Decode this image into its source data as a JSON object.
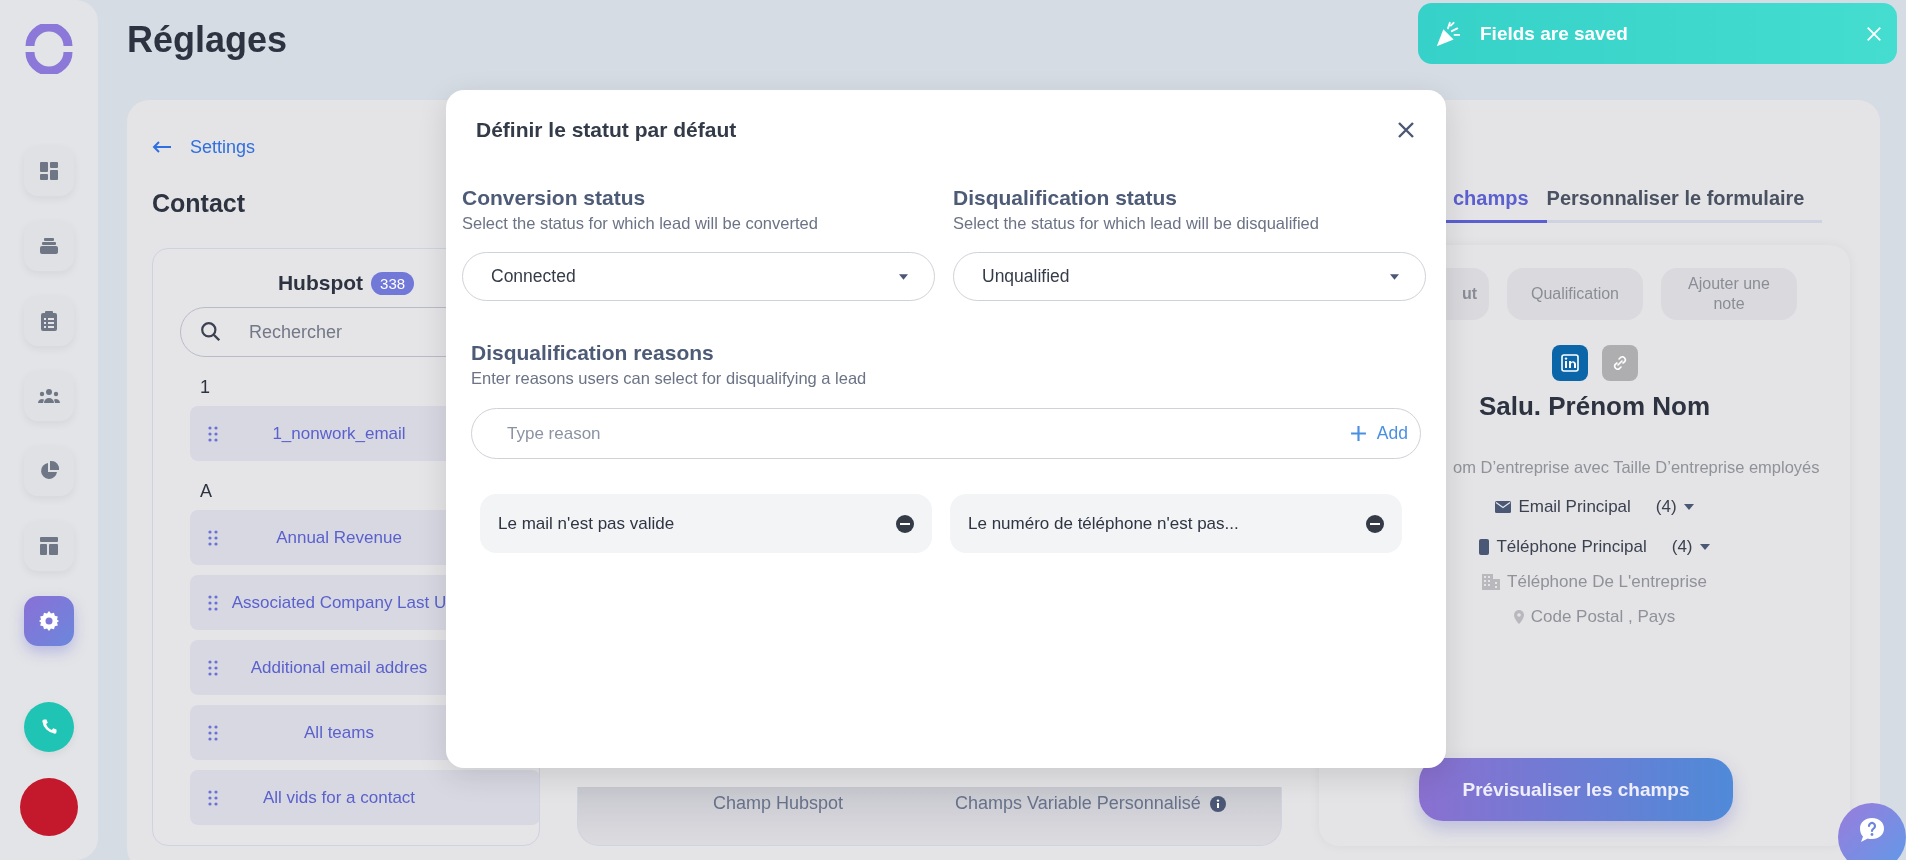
{
  "sidebar": {
    "items": [
      {
        "kind": "dashboard",
        "selected": false
      },
      {
        "kind": "stack",
        "selected": false
      },
      {
        "kind": "clipboard",
        "selected": false
      },
      {
        "kind": "team",
        "selected": false
      },
      {
        "kind": "pie",
        "selected": false
      },
      {
        "kind": "layout",
        "selected": false
      },
      {
        "kind": "settings",
        "selected": true
      },
      {
        "kind": "phone",
        "selected": false
      }
    ]
  },
  "page_title": "Réglages",
  "back_link": "Settings",
  "section_title": "Contact",
  "source_panel": {
    "title": "Hubspot",
    "count": "338",
    "search": {
      "placeholder": "Rechercher"
    },
    "groups": [
      {
        "letter": "1",
        "fields": [
          "1_nonwork_email"
        ]
      },
      {
        "letter": "A",
        "fields": [
          "Annual Revenue",
          "Associated Company Last U",
          "Additional email addres",
          "All teams",
          "All vids for a contact"
        ]
      }
    ]
  },
  "mapping_table": {
    "columns": [
      "Champ Hubspot",
      "Champs Variable Personnalisé"
    ]
  },
  "form_tabs": [
    {
      "label": "champs",
      "selected": true
    },
    {
      "label": "Personnaliser le formulaire",
      "selected": false
    }
  ],
  "preview": {
    "chips": [
      "ut",
      "Qualification",
      "Ajouter une note"
    ],
    "name": "Salu. Prénom Nom",
    "company_line": "om D’entreprise avec Taille D’entreprise employés",
    "contacts": [
      {
        "kind": "email",
        "label": "Email Principal",
        "count": "(4)"
      },
      {
        "kind": "phone",
        "label": "Téléphone Principal",
        "count": "(4)"
      },
      {
        "kind": "company_phone",
        "label": "Téléphone De L'entreprise"
      },
      {
        "kind": "location",
        "label": "Code Postal , Pays"
      }
    ],
    "button": "Prévisualiser les champs"
  },
  "toast": {
    "message": "Fields are saved"
  },
  "modal": {
    "title": "Définir le statut par défaut",
    "selects": [
      {
        "label": "Conversion status",
        "hint": "Select the status for which lead will be converted",
        "value": "Connected"
      },
      {
        "label": "Disqualification status",
        "hint": "Select the status for which lead will be disqualified",
        "value": "Unqualified"
      }
    ],
    "reasons": {
      "label": "Disqualification reasons",
      "hint": "Enter reasons users can select for disqualifying a lead",
      "placeholder": "Type reason",
      "add": "Add",
      "items": [
        "Le mail n'est pas valide",
        "Le numéro de téléphone n'est pas..."
      ]
    }
  }
}
